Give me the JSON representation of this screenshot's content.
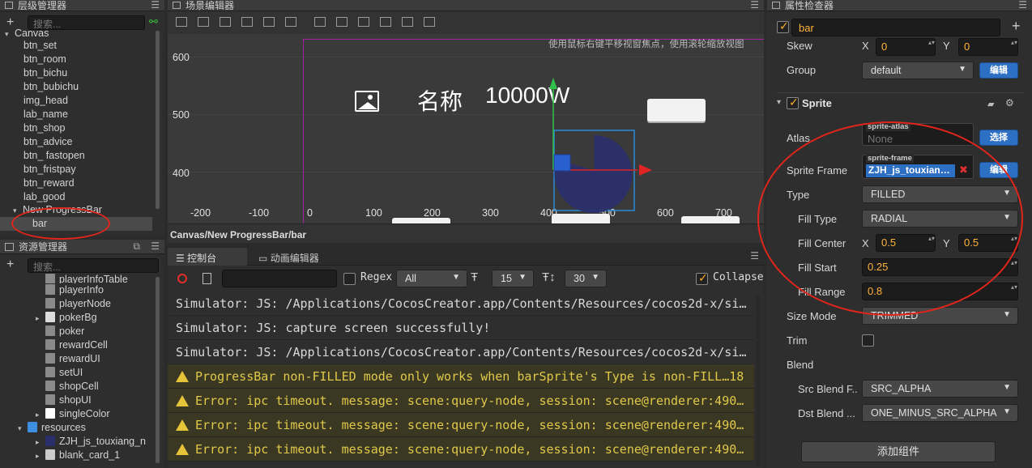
{
  "hierarchy": {
    "title": "层级管理器",
    "search_placeholder": "搜索...",
    "root": "Canvas",
    "items": [
      "btn_set",
      "btn_room",
      "btn_bichu",
      "btn_bubichu",
      "img_head",
      "lab_name",
      "btn_shop",
      "btn_advice",
      "btn_ fastopen",
      "btn_fristpay",
      "btn_reward",
      "lab_good"
    ],
    "group": "New ProgressBar",
    "selected": "bar"
  },
  "assets": {
    "title": "资源管理器",
    "search_placeholder": "搜索...",
    "items": [
      "playerInfoTable",
      "playerInfo",
      "playerNode",
      "pokerBg",
      "poker",
      "rewardCell",
      "rewardUI",
      "setUI",
      "shopCell",
      "shopUI",
      "singleColor"
    ],
    "folder": "resources",
    "sub_items": [
      "ZJH_js_touxiang_n",
      "blank_card_1"
    ]
  },
  "scene": {
    "title": "场景编辑器",
    "hint": "使用鼠标右键平移视窗焦点，使用滚轮缩放视图",
    "y_ticks": [
      "600",
      "500",
      "400"
    ],
    "x_ticks": [
      "-200",
      "-100",
      "0",
      "100",
      "200",
      "300",
      "400",
      "500",
      "600",
      "700"
    ],
    "label_name": "名称",
    "label_value": "10000W",
    "breadcrumb": "Canvas/New ProgressBar/bar"
  },
  "console": {
    "tab_console": "控制台",
    "tab_anim": "动画编辑器",
    "regex_label": "Regex",
    "filter_select": "All",
    "font_size": "15",
    "line_height": "30",
    "collapse_label": "Collapse",
    "lines": [
      {
        "type": "log",
        "text": "Simulator: JS: /Applications/CocosCreator.app/Contents/Resources/cocos2d-x/si…"
      },
      {
        "type": "log",
        "text": "Simulator: JS: capture screen successfully!"
      },
      {
        "type": "log",
        "text": "Simulator: JS: /Applications/CocosCreator.app/Contents/Resources/cocos2d-x/si…"
      },
      {
        "type": "warn",
        "text": "ProgressBar non-FILLED mode only works when barSprite's Type is non-FILL…18"
      },
      {
        "type": "warn",
        "text": "Error: ipc timeout. message: scene:query-node, session: scene@renderer:490…"
      },
      {
        "type": "warn",
        "text": "Error: ipc timeout. message: scene:query-node, session: scene@renderer:490…"
      },
      {
        "type": "warn",
        "text": "Error: ipc timeout. message: scene:query-node, session: scene@renderer:490…"
      }
    ]
  },
  "inspector": {
    "title": "属性检查器",
    "node_name": "bar",
    "skew_label": "Skew",
    "skew_x": "0",
    "skew_y": "0",
    "group_label": "Group",
    "group_value": "default",
    "edit_btn": "编辑",
    "sprite_label": "Sprite",
    "atlas_label": "Atlas",
    "atlas_tag": "sprite-atlas",
    "atlas_value": "None",
    "select_btn": "选择",
    "frame_label": "Sprite Frame",
    "frame_tag": "sprite-frame",
    "frame_value": "ZJH_js_touxian…",
    "type_label": "Type",
    "type_value": "FILLED",
    "fill_type_label": "Fill Type",
    "fill_type_value": "RADIAL",
    "fill_center_label": "Fill Center",
    "fill_center_x": "0.5",
    "fill_center_y": "0.5",
    "fill_start_label": "Fill Start",
    "fill_start_value": "0.25",
    "fill_range_label": "Fill Range",
    "fill_range_value": "0.8",
    "size_mode_label": "Size Mode",
    "size_mode_value": "TRIMMED",
    "trim_label": "Trim",
    "blend_label": "Blend",
    "src_blend_label": "Src Blend F..",
    "src_blend_value": "SRC_ALPHA",
    "dst_blend_label": "Dst Blend ...",
    "dst_blend_value": "ONE_MINUS_SRC_ALPHA",
    "add_component_btn": "添加组件",
    "x_label": "X",
    "y_label": "Y"
  }
}
